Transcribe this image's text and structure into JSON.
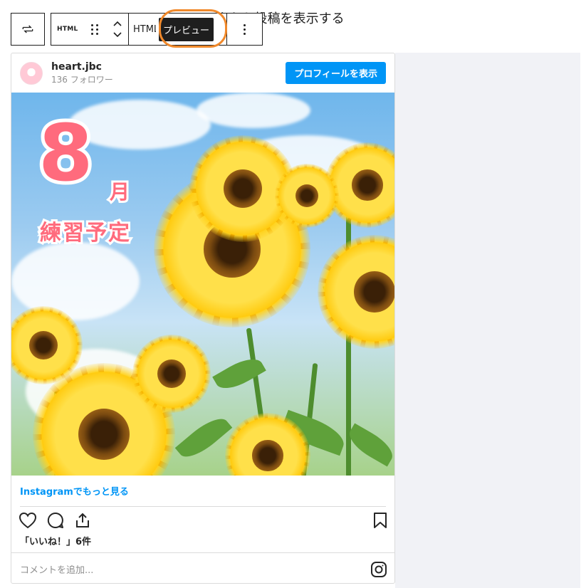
{
  "heading": {
    "visible_text": "ンスタから投稿を表示する"
  },
  "toolbar": {
    "transform_icon": "transform-arrows-icon",
    "block_icon_label": "HTML",
    "tab_html_label": "HTML",
    "tab_preview_label": "プレビュー",
    "options_icon": "kebab-menu-icon"
  },
  "instagram": {
    "username": "heart.jbc",
    "followers": "136 フォロワー",
    "profile_button": "プロフィールを表示",
    "post_image_text": {
      "number": "8",
      "month": "月",
      "caption": "練習予定"
    },
    "more_link": "Instagramでもっと見る",
    "likes": "「いいね！」6件",
    "comment_placeholder": "コメントを追加...",
    "colors": {
      "accent": "#0095f6",
      "highlight": "#f0892b",
      "title_pink": "#ff6b7d"
    }
  }
}
